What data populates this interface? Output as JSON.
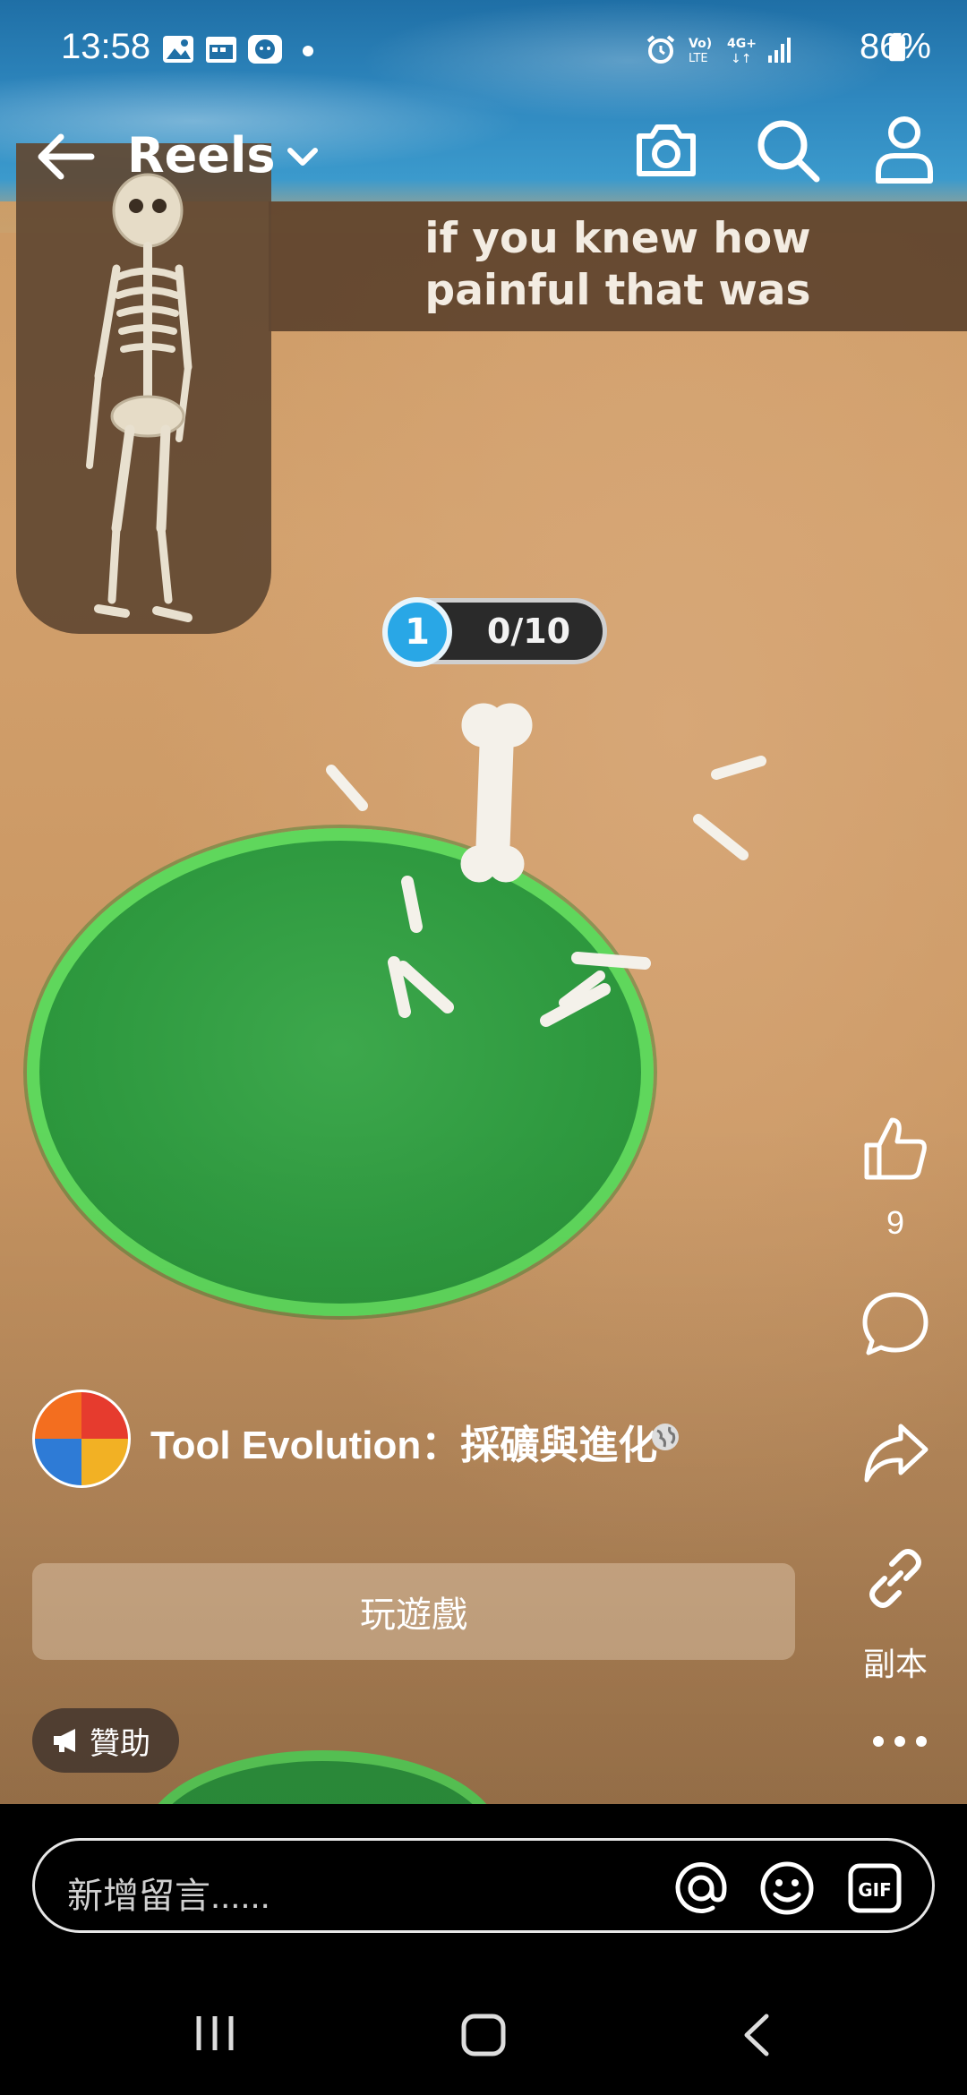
{
  "status_bar": {
    "time": "13:58",
    "battery": "86%",
    "icons": [
      "gallery-icon",
      "calendar-icon",
      "messenger-icon",
      "dot-icon",
      "alarm-icon",
      "volte-icon",
      "4g-icon",
      "signal-icon",
      "battery-icon"
    ]
  },
  "nav": {
    "title": "Reels",
    "icons": [
      "back-arrow-icon",
      "chevron-down-icon",
      "camera-icon",
      "search-icon",
      "profile-icon"
    ]
  },
  "video": {
    "caption": "if you knew how painful that was",
    "counter_level": "1",
    "counter_progress": "0/10"
  },
  "actions": {
    "like_count": "9",
    "copy_label": "副本",
    "icons": [
      "like-icon",
      "comment-icon",
      "share-icon",
      "link-icon",
      "more-icon"
    ]
  },
  "advertiser": {
    "name": "Tool Evolution：採礦與進化",
    "privacy_icon": "globe-icon"
  },
  "cta": {
    "label": "玩遊戲"
  },
  "sponsor": {
    "label": "贊助",
    "icon": "megaphone-icon"
  },
  "comment": {
    "placeholder": "新增留言......",
    "icons": [
      "mention-icon",
      "emoji-icon",
      "gif-icon"
    ]
  },
  "system_nav": {
    "icons": [
      "recents-icon",
      "home-icon",
      "back-icon"
    ]
  },
  "colors": {
    "grass": "#2f9a40",
    "grass_rim": "#5fd75c",
    "sand": "#c99761",
    "water": "#2f88bf",
    "level_badge": "#29a7e6"
  }
}
